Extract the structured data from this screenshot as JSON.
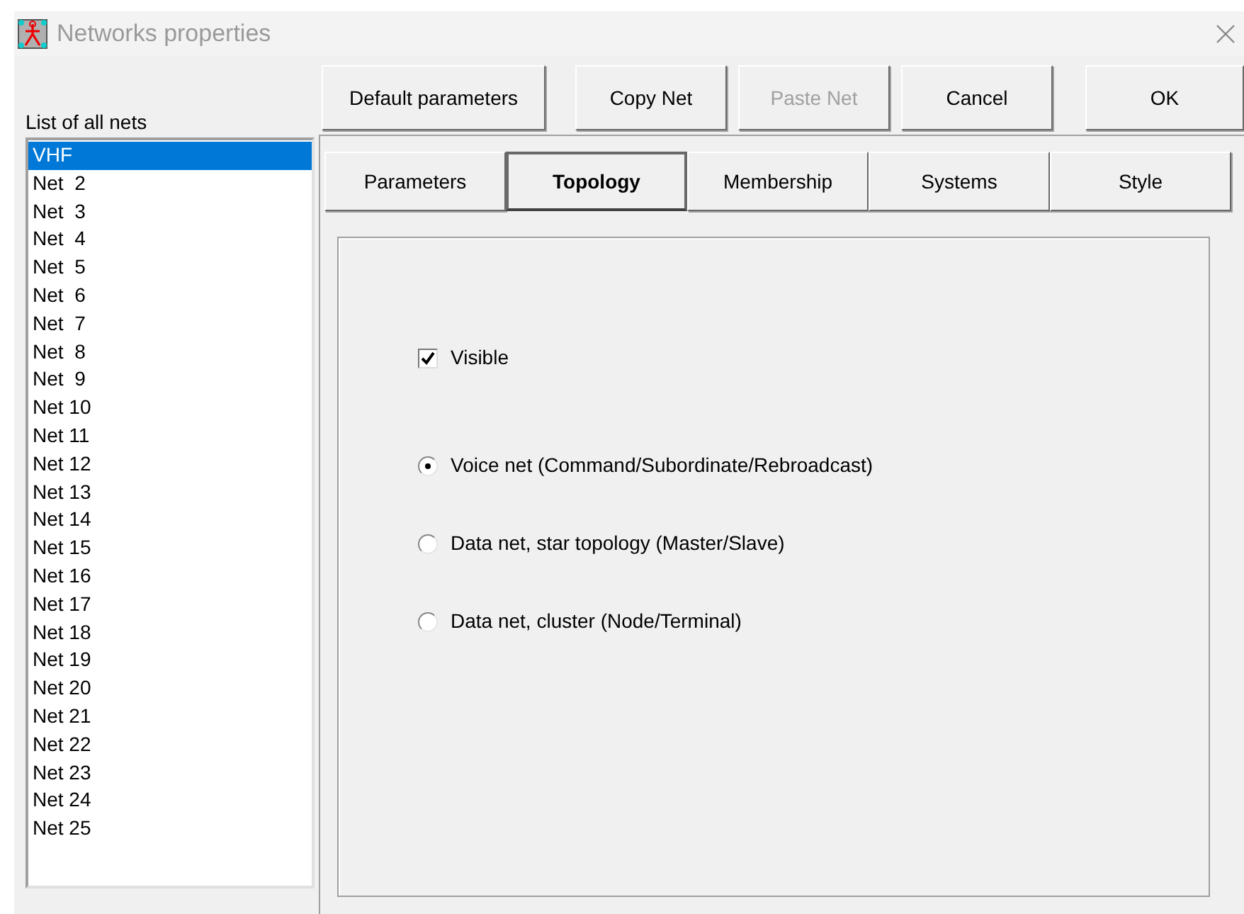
{
  "window": {
    "title": "Networks properties"
  },
  "nets_list": {
    "label": "List of all nets",
    "items": [
      {
        "label": "VHF",
        "selected": true
      },
      {
        "label": "Net  2",
        "selected": false
      },
      {
        "label": "Net  3",
        "selected": false
      },
      {
        "label": "Net  4",
        "selected": false
      },
      {
        "label": "Net  5",
        "selected": false
      },
      {
        "label": "Net  6",
        "selected": false
      },
      {
        "label": "Net  7",
        "selected": false
      },
      {
        "label": "Net  8",
        "selected": false
      },
      {
        "label": "Net  9",
        "selected": false
      },
      {
        "label": "Net 10",
        "selected": false
      },
      {
        "label": "Net 11",
        "selected": false
      },
      {
        "label": "Net 12",
        "selected": false
      },
      {
        "label": "Net 13",
        "selected": false
      },
      {
        "label": "Net 14",
        "selected": false
      },
      {
        "label": "Net 15",
        "selected": false
      },
      {
        "label": "Net 16",
        "selected": false
      },
      {
        "label": "Net 17",
        "selected": false
      },
      {
        "label": "Net 18",
        "selected": false
      },
      {
        "label": "Net 19",
        "selected": false
      },
      {
        "label": "Net 20",
        "selected": false
      },
      {
        "label": "Net 21",
        "selected": false
      },
      {
        "label": "Net 22",
        "selected": false
      },
      {
        "label": "Net 23",
        "selected": false
      },
      {
        "label": "Net 24",
        "selected": false
      },
      {
        "label": "Net 25",
        "selected": false
      }
    ]
  },
  "buttons": [
    {
      "label": "Default parameters",
      "disabled": false
    },
    {
      "label": "Copy Net",
      "disabled": false
    },
    {
      "label": "Paste Net",
      "disabled": true
    },
    {
      "label": "Cancel",
      "disabled": false
    },
    {
      "label": "OK",
      "disabled": false
    }
  ],
  "tabs": [
    {
      "label": "Parameters",
      "selected": false
    },
    {
      "label": "Topology",
      "selected": true
    },
    {
      "label": "Membership",
      "selected": false
    },
    {
      "label": "Systems",
      "selected": false
    },
    {
      "label": "Style",
      "selected": false
    }
  ],
  "topology": {
    "visible": {
      "label": "Visible",
      "checked": true
    },
    "net_types": [
      {
        "label": "Voice net (Command/Subordinate/Rebroadcast)",
        "selected": true
      },
      {
        "label": "Data net, star topology (Master/Slave)",
        "selected": false
      },
      {
        "label": "Data net, cluster (Node/Terminal)",
        "selected": false
      }
    ]
  }
}
